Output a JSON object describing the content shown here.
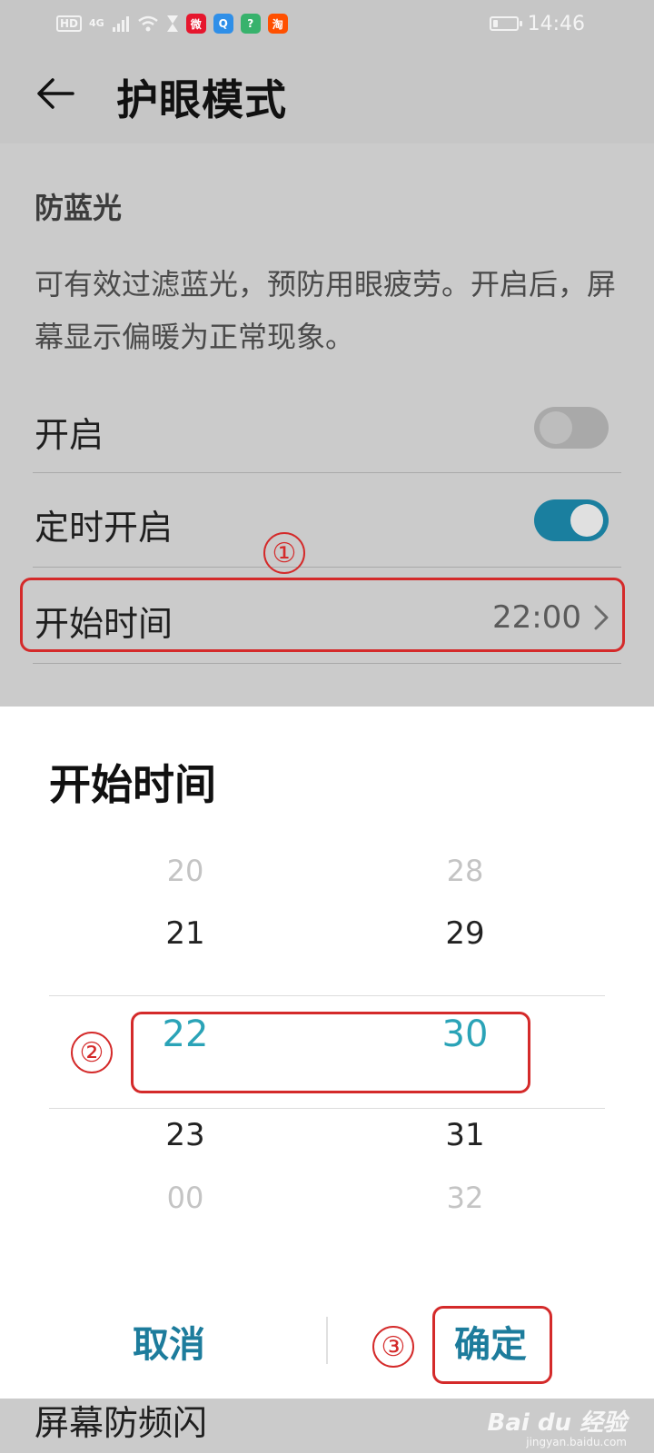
{
  "status_bar": {
    "network_badge": "HD",
    "signal_type": "4G",
    "apps": [
      {
        "icon": "weibo-icon",
        "label": "微",
        "color": "#e6162d"
      },
      {
        "icon": "qq-browser-icon",
        "label": "Q",
        "color": "#2f8fe8"
      },
      {
        "icon": "question-app-icon",
        "label": "?",
        "color": "#37b26c"
      },
      {
        "icon": "taobao-icon",
        "label": "淘",
        "color": "#ff5000"
      }
    ],
    "battery_level": 0.2,
    "time": "14:46"
  },
  "header": {
    "title": "护眼模式"
  },
  "content": {
    "section_title": "防蓝光",
    "description": "可有效过滤蓝光，预防用眼疲劳。开启后，屏幕显示偏暖为正常现象。",
    "enable_label": "开启",
    "enable_on": false,
    "schedule_label": "定时开启",
    "schedule_on": true,
    "start_time_label": "开始时间",
    "start_time_value": "22:00"
  },
  "picker": {
    "title": "开始时间",
    "hours": [
      "20",
      "21",
      "22",
      "23",
      "00"
    ],
    "minutes": [
      "28",
      "29",
      "30",
      "31",
      "32"
    ],
    "selected_hour": "22",
    "selected_minute": "30",
    "cancel_label": "取消",
    "confirm_label": "确定"
  },
  "annotations": {
    "one": "①",
    "two": "②",
    "three": "③"
  },
  "peek_text": "屏幕防频闪",
  "watermark": {
    "logo": "Bai du 经验",
    "sub": "jingyan.baidu.com"
  },
  "colors": {
    "accent": "#1d7c9c",
    "selected": "#2aa3b7",
    "annotation": "#d42a2a"
  }
}
